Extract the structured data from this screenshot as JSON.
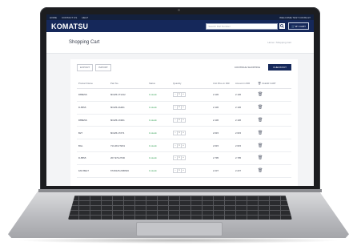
{
  "topbar": {
    "links": [
      "HOME",
      "CONTACT US",
      "HELP"
    ],
    "right": "WELCOME TEST CONSULT"
  },
  "header": {
    "logo": "KOMATSU",
    "search_placeholder": "Search Part Number",
    "cart_label": "MY CART"
  },
  "page": {
    "title": "Shopping Cart",
    "breadcrumb": "Home  /  Shopping Cart"
  },
  "actions": {
    "export": "EXPORT",
    "import": "IMPORT",
    "continue": "CONTINUE SHOPPING",
    "checkout": "CHECKOUT"
  },
  "table": {
    "headers": [
      "Product Name",
      "Part No.",
      "Status",
      "Quantity",
      "Unit Price in IDR",
      "Amount in IDR",
      "CLEAR CART"
    ],
    "rows": [
      {
        "name": "D85ESS",
        "part": "6D125-1T1212",
        "status": "In stock",
        "qty": "1",
        "unit": "2.136",
        "amount": "2.136"
      },
      {
        "name": "D-85S5",
        "part": "6D125-2A2D1",
        "status": "In stock",
        "qty": "1",
        "unit": "2.136",
        "amount": "2.136"
      },
      {
        "name": "D85ESS",
        "part": "6D125-1X2D1",
        "status": "In stock",
        "qty": "1",
        "unit": "2.136",
        "amount": "2.136"
      },
      {
        "name": "B2T",
        "part": "6D125-1T2T4",
        "status": "In stock",
        "qty": "1",
        "unit": "2.615",
        "amount": "2.615"
      },
      {
        "name": "BGL",
        "part": "713-48-2T2D1",
        "status": "In stock",
        "qty": "1",
        "unit": "2.615",
        "amount": "2.615"
      },
      {
        "name": "D-85S5",
        "part": "207-979-2T2D",
        "status": "In stock",
        "qty": "1",
        "unit": "2.795",
        "amount": "2.795"
      },
      {
        "name": "FAN BELT",
        "part": "6T2D125-2NBS93",
        "status": "In stock",
        "qty": "1",
        "unit": "2.237",
        "amount": "2.237"
      }
    ]
  },
  "icons": {
    "search": "search-icon",
    "cart": "cart-icon",
    "trash": "trash-icon"
  },
  "colors": {
    "brand_navy": "#15285a",
    "topbar": "#13203d",
    "status_green": "#2e9e4f"
  }
}
